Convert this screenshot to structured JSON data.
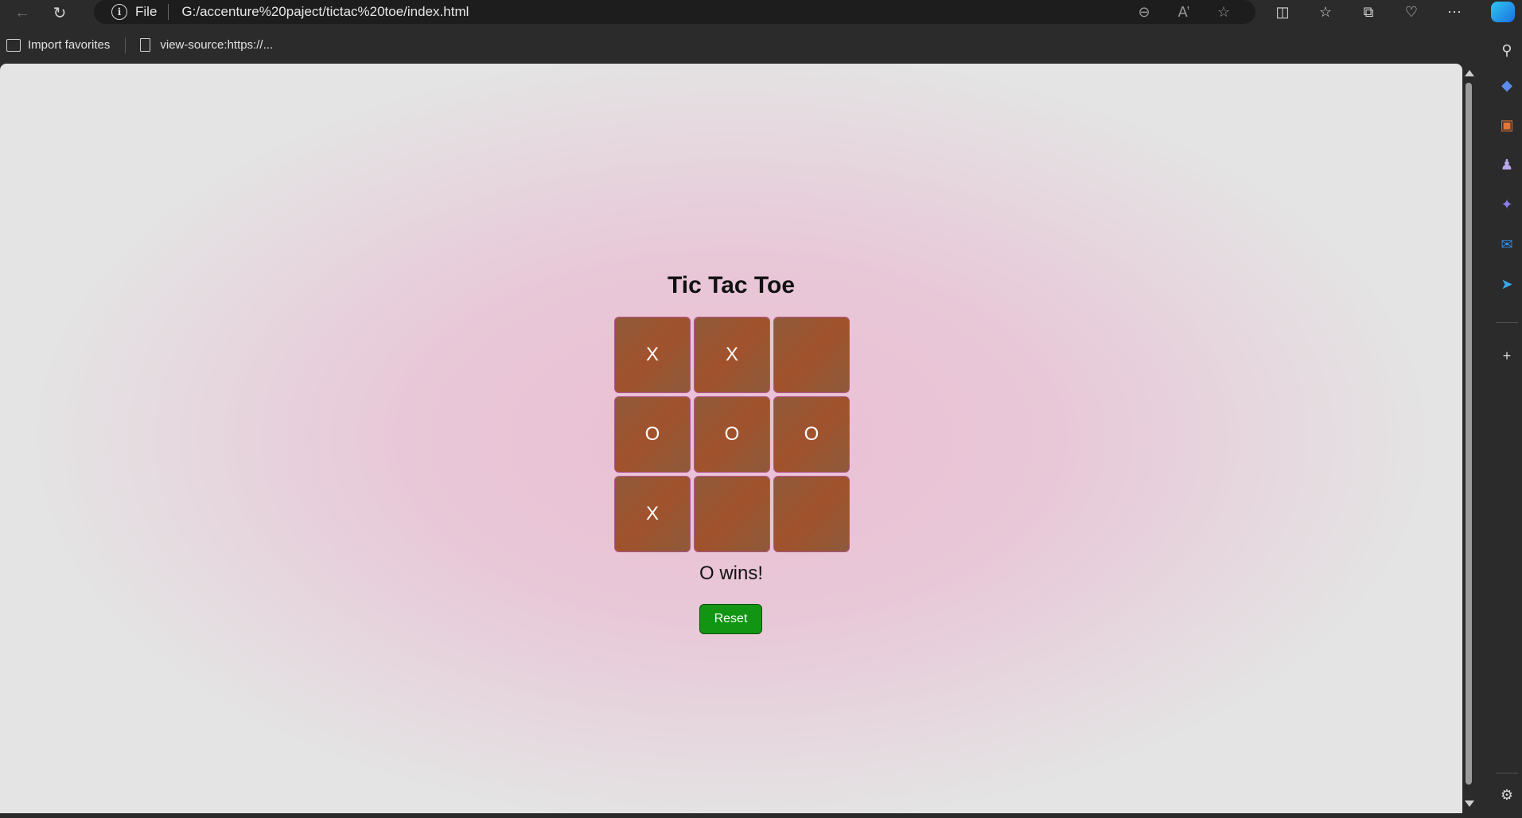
{
  "browser": {
    "address": {
      "scheme": "File",
      "url": "G:/accenture%20paject/tictac%20toe/index.html"
    },
    "address_icons": [
      "zoom-out-icon",
      "read-aloud-icon",
      "favorite-star-icon"
    ],
    "toolbar_icons": [
      "split-screen-icon",
      "favorites-icon",
      "collections-icon",
      "browser-essentials-icon",
      "more-icon",
      "copilot-icon"
    ],
    "favorites": [
      {
        "label": "Import favorites",
        "icon": "import-favorites-icon"
      },
      {
        "label": "view-source:https://...",
        "icon": "page-icon"
      }
    ],
    "sidebar_icons": [
      "search-icon",
      "shopping-icon",
      "tools-icon",
      "games-icon",
      "copilot-app-icon",
      "outlook-icon",
      "send-icon",
      "add-icon",
      "settings-icon"
    ],
    "colors": {
      "chrome": "#2b2b2b",
      "address_bg": "#1d1d1d"
    }
  },
  "game": {
    "title": "Tic Tac Toe",
    "board": [
      "X",
      "X",
      "",
      "O",
      "O",
      "O",
      "X",
      "",
      ""
    ],
    "status": "O wins!",
    "reset_label": "Reset",
    "colors": {
      "cell": "#a1522c",
      "cell_border": "#b0558a",
      "reset_button": "#129512",
      "background_center": "#ebbfd5",
      "background_edge": "#e4e4e4"
    }
  }
}
